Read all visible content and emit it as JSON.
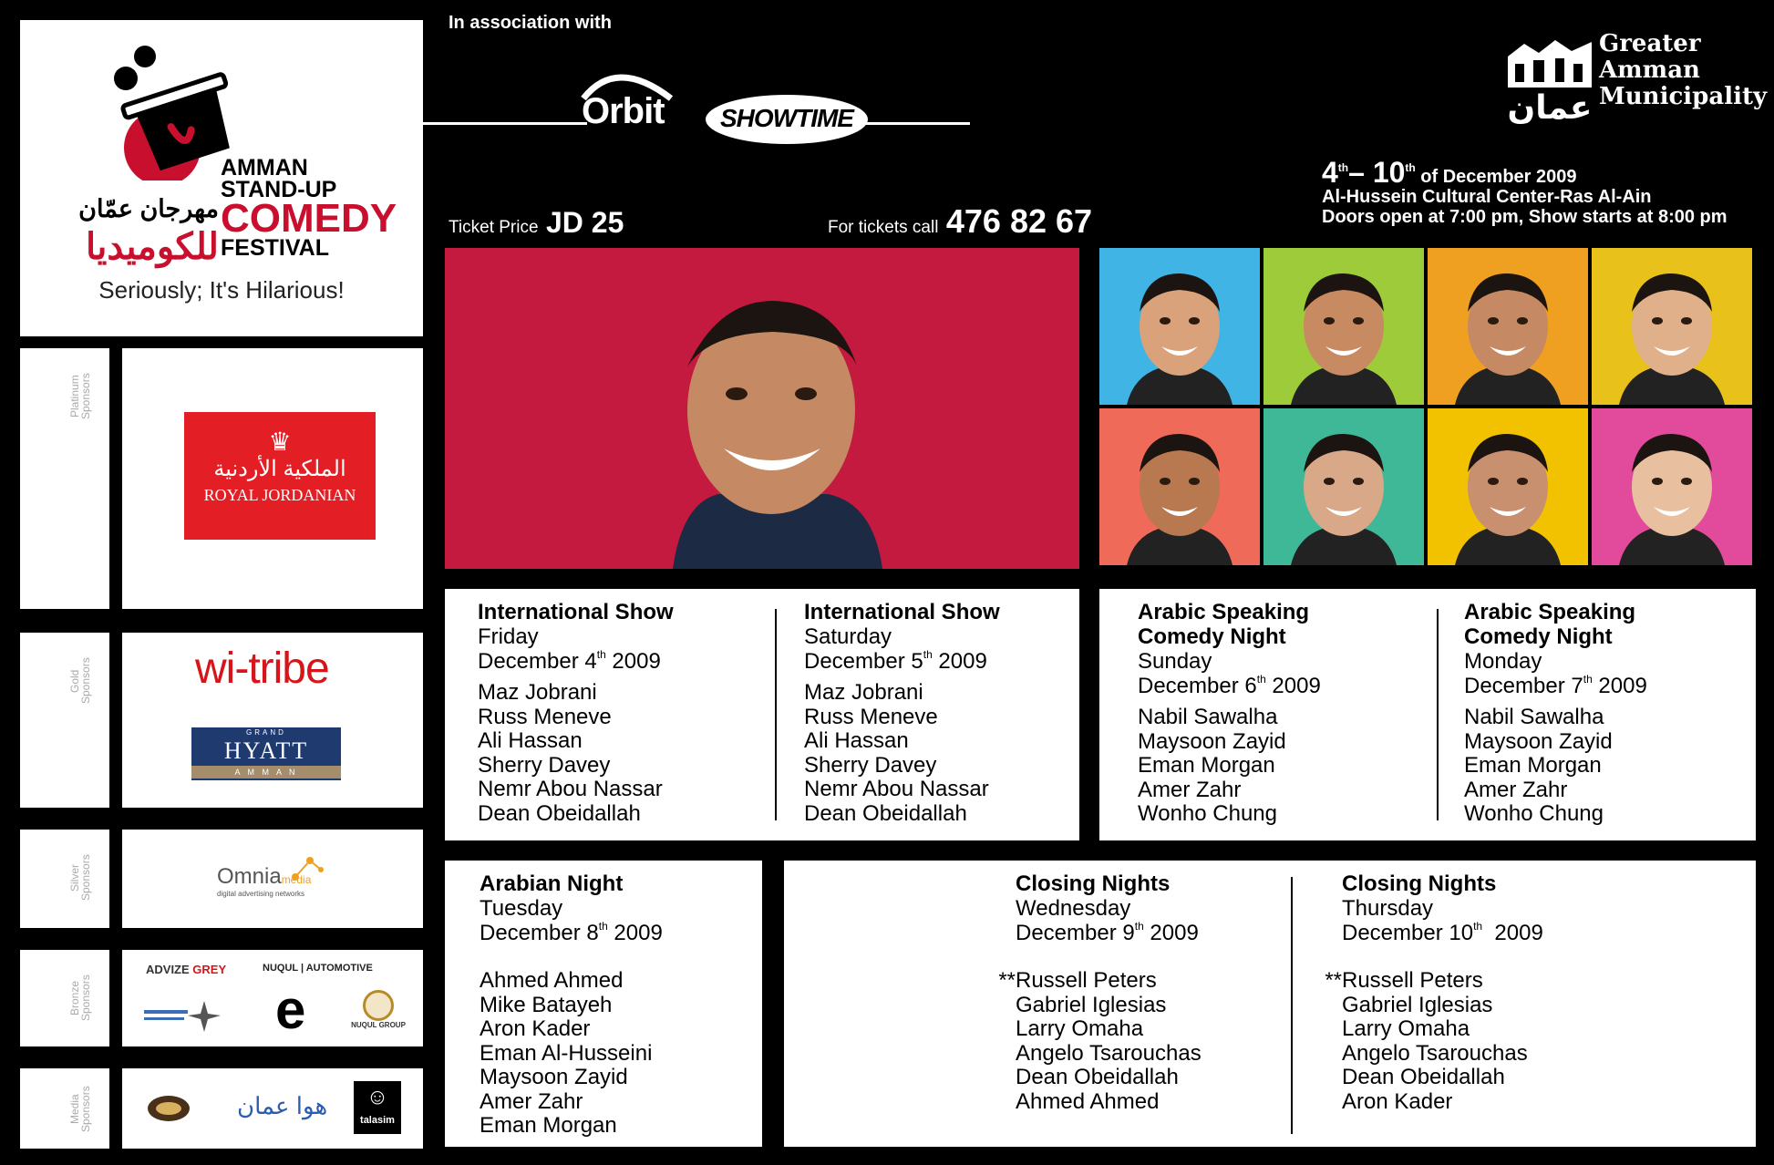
{
  "logo": {
    "english": [
      "AMMAN",
      "STAND-UP",
      "COMEDY",
      "FESTIVAL"
    ],
    "arabic_1": "مهرجان عمّان",
    "arabic_2": "للكوميديا",
    "tagline": "Seriously; It's Hilarious!"
  },
  "association": {
    "label": "In association with",
    "orbit": "Orbit",
    "showtime": "SHOWTIME"
  },
  "municipality": [
    "Greater",
    "Amman",
    "Municipality"
  ],
  "municipality_emblem": "عمان",
  "tickets": {
    "price_label": "Ticket Price",
    "price": "JD 25",
    "call_label": "For tickets call",
    "phone": "476 82 67"
  },
  "event": {
    "date_start": "4",
    "date_start_sup": "th",
    "dash": "– ",
    "date_end": "10",
    "date_end_sup": "th",
    "date_rest": " of December 2009",
    "venue": "Al-Hussein Cultural Center-Ras Al-Ain",
    "doors": "Doors open at 7:00 pm, Show starts at 8:00 pm"
  },
  "sponsor_tiers": [
    {
      "label": "Platinum Sponsors"
    },
    {
      "label": "Gold Sponsors"
    },
    {
      "label": "Silver Sponsors"
    },
    {
      "label": "Bronze Sponsors"
    },
    {
      "label": "Media Sponsors"
    }
  ],
  "sponsors": {
    "royal_jordanian": {
      "arabic": "الملكية الأردنية",
      "english": "ROYAL JORDANIAN"
    },
    "witribe": "wi-tribe",
    "hyatt": {
      "top": "GRAND",
      "name": "HYATT",
      "bottom": "A M M A N"
    },
    "omnia": {
      "name": "Omnia",
      "suffix": "media",
      "sub": "digital advertising networks"
    },
    "bronze": {
      "advize": "ADVIZE",
      "grey": "GREY",
      "nuqul": "NUQUL | AUTOMOTIVE",
      "e": "e",
      "nuqul_group": "NUQUL GROUP"
    },
    "media": {
      "hawa": "هوا عمان",
      "talasim": "talasim"
    }
  },
  "shows": {
    "intl_fri": {
      "title": "International Show",
      "day": "Friday",
      "date": "December 4",
      "sup": "th",
      "year": " 2009",
      "names": [
        "Maz Jobrani",
        "Russ Meneve",
        "Ali Hassan",
        "Sherry Davey",
        "Nemr Abou Nassar",
        "Dean Obeidallah"
      ]
    },
    "intl_sat": {
      "title": "International Show",
      "day": "Saturday",
      "date": "December 5",
      "sup": "th",
      "year": " 2009",
      "names": [
        "Maz Jobrani",
        "Russ Meneve",
        "Ali Hassan",
        "Sherry Davey",
        "Nemr Abou Nassar",
        "Dean Obeidallah"
      ]
    },
    "arabic_sun": {
      "title1": "Arabic Speaking",
      "title2": "Comedy Night",
      "day": "Sunday",
      "date": "December 6",
      "sup": "th",
      "year": " 2009",
      "names": [
        "Nabil Sawalha",
        "Maysoon Zayid",
        "Eman Morgan",
        "Amer Zahr",
        "Wonho Chung"
      ]
    },
    "arabic_mon": {
      "title1": "Arabic Speaking",
      "title2": "Comedy Night",
      "day": "Monday",
      "date": "December 7",
      "sup": "th",
      "year": " 2009",
      "names": [
        "Nabil Sawalha",
        "Maysoon Zayid",
        "Eman Morgan",
        "Amer Zahr",
        "Wonho Chung"
      ]
    },
    "arabian_tue": {
      "title": "Arabian Night",
      "day": "Tuesday",
      "date": "December 8",
      "sup": "th",
      "year": " 2009",
      "names": [
        "Ahmed Ahmed",
        "Mike Batayeh",
        "Aron Kader",
        "Eman Al-Husseini",
        "Maysoon Zayid",
        "Amer Zahr",
        "Eman Morgan"
      ]
    },
    "closing_wed": {
      "title": "Closing Nights",
      "day": "Wednesday",
      "date": "December 9",
      "sup": "th",
      "year": " 2009",
      "star": "**",
      "names": [
        "Russell Peters",
        "Gabriel Iglesias",
        "Larry Omaha",
        "Angelo Tsarouchas",
        "Dean Obeidallah",
        "Ahmed Ahmed"
      ]
    },
    "closing_thu": {
      "title": "Closing Nights",
      "day": "Thursday",
      "date": "December 10",
      "sup": "th",
      "year": "  2009",
      "star": "**",
      "names": [
        "Russell Peters",
        "Gabriel Iglesias",
        "Larry Omaha",
        "Angelo Tsarouchas",
        "Dean Obeidallah",
        "Aron Kader"
      ]
    }
  },
  "colors": {
    "logo_red": "#c8102e",
    "hero_bg": "#c41a3f",
    "rj_red": "#e31e24",
    "hyatt_blue": "#1e3a6e",
    "witribe_red": "#d7141a",
    "grid": [
      "#3fb4e5",
      "#9ecb3a",
      "#f0a020",
      "#e8c21a",
      "#f06a5a",
      "#3fb898",
      "#f2c200",
      "#e24a9c"
    ]
  }
}
